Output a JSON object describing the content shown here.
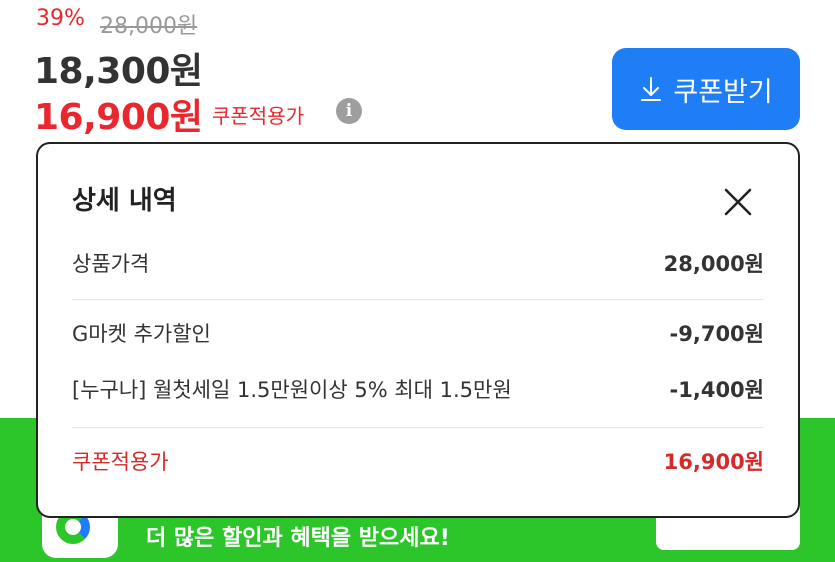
{
  "price": {
    "discount_rate": "39%",
    "original_price": "28,000원",
    "sale_price": "18,300원",
    "coupon_price": "16,900원",
    "coupon_price_label": "쿠폰적용가",
    "info_icon": "i"
  },
  "coupon_button": {
    "label": "쿠폰받기",
    "icon": "download-arrow-icon",
    "color": "#1f7ef5"
  },
  "modal": {
    "title": "상세 내역",
    "close_icon": "close-icon",
    "rows": [
      {
        "label": "상품가격",
        "amount": "28,000원"
      },
      {
        "label": "G마켓 추가할인",
        "amount": "-9,700원"
      },
      {
        "label": "[누구나] 월첫세일 1.5만원이상 5% 최대 1.5만원",
        "amount": "-1,400원"
      },
      {
        "label": "쿠폰적용가",
        "amount": "16,900원"
      }
    ]
  },
  "promo_banner": {
    "text": "더 많은 할인과 혜택을 받으세요!",
    "color": "#2cc62a"
  },
  "colors": {
    "accent_red": "#e8272e",
    "muted_gray": "#9a9a9a"
  }
}
